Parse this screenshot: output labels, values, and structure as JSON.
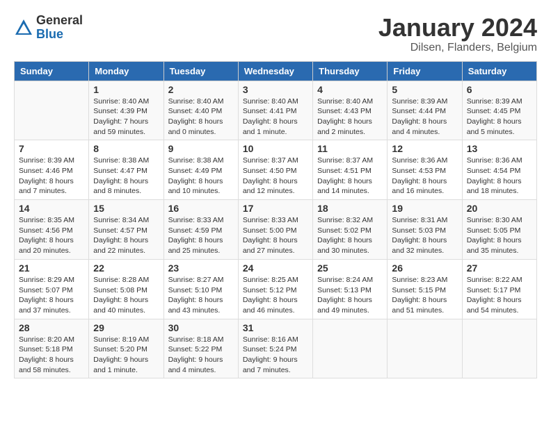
{
  "header": {
    "logo_general": "General",
    "logo_blue": "Blue",
    "month_year": "January 2024",
    "location": "Dilsen, Flanders, Belgium"
  },
  "days_of_week": [
    "Sunday",
    "Monday",
    "Tuesday",
    "Wednesday",
    "Thursday",
    "Friday",
    "Saturday"
  ],
  "weeks": [
    [
      {
        "day": "",
        "content": ""
      },
      {
        "day": "1",
        "content": "Sunrise: 8:40 AM\nSunset: 4:39 PM\nDaylight: 7 hours\nand 59 minutes."
      },
      {
        "day": "2",
        "content": "Sunrise: 8:40 AM\nSunset: 4:40 PM\nDaylight: 8 hours\nand 0 minutes."
      },
      {
        "day": "3",
        "content": "Sunrise: 8:40 AM\nSunset: 4:41 PM\nDaylight: 8 hours\nand 1 minute."
      },
      {
        "day": "4",
        "content": "Sunrise: 8:40 AM\nSunset: 4:43 PM\nDaylight: 8 hours\nand 2 minutes."
      },
      {
        "day": "5",
        "content": "Sunrise: 8:39 AM\nSunset: 4:44 PM\nDaylight: 8 hours\nand 4 minutes."
      },
      {
        "day": "6",
        "content": "Sunrise: 8:39 AM\nSunset: 4:45 PM\nDaylight: 8 hours\nand 5 minutes."
      }
    ],
    [
      {
        "day": "7",
        "content": "Sunrise: 8:39 AM\nSunset: 4:46 PM\nDaylight: 8 hours\nand 7 minutes."
      },
      {
        "day": "8",
        "content": "Sunrise: 8:38 AM\nSunset: 4:47 PM\nDaylight: 8 hours\nand 8 minutes."
      },
      {
        "day": "9",
        "content": "Sunrise: 8:38 AM\nSunset: 4:49 PM\nDaylight: 8 hours\nand 10 minutes."
      },
      {
        "day": "10",
        "content": "Sunrise: 8:37 AM\nSunset: 4:50 PM\nDaylight: 8 hours\nand 12 minutes."
      },
      {
        "day": "11",
        "content": "Sunrise: 8:37 AM\nSunset: 4:51 PM\nDaylight: 8 hours\nand 14 minutes."
      },
      {
        "day": "12",
        "content": "Sunrise: 8:36 AM\nSunset: 4:53 PM\nDaylight: 8 hours\nand 16 minutes."
      },
      {
        "day": "13",
        "content": "Sunrise: 8:36 AM\nSunset: 4:54 PM\nDaylight: 8 hours\nand 18 minutes."
      }
    ],
    [
      {
        "day": "14",
        "content": "Sunrise: 8:35 AM\nSunset: 4:56 PM\nDaylight: 8 hours\nand 20 minutes."
      },
      {
        "day": "15",
        "content": "Sunrise: 8:34 AM\nSunset: 4:57 PM\nDaylight: 8 hours\nand 22 minutes."
      },
      {
        "day": "16",
        "content": "Sunrise: 8:33 AM\nSunset: 4:59 PM\nDaylight: 8 hours\nand 25 minutes."
      },
      {
        "day": "17",
        "content": "Sunrise: 8:33 AM\nSunset: 5:00 PM\nDaylight: 8 hours\nand 27 minutes."
      },
      {
        "day": "18",
        "content": "Sunrise: 8:32 AM\nSunset: 5:02 PM\nDaylight: 8 hours\nand 30 minutes."
      },
      {
        "day": "19",
        "content": "Sunrise: 8:31 AM\nSunset: 5:03 PM\nDaylight: 8 hours\nand 32 minutes."
      },
      {
        "day": "20",
        "content": "Sunrise: 8:30 AM\nSunset: 5:05 PM\nDaylight: 8 hours\nand 35 minutes."
      }
    ],
    [
      {
        "day": "21",
        "content": "Sunrise: 8:29 AM\nSunset: 5:07 PM\nDaylight: 8 hours\nand 37 minutes."
      },
      {
        "day": "22",
        "content": "Sunrise: 8:28 AM\nSunset: 5:08 PM\nDaylight: 8 hours\nand 40 minutes."
      },
      {
        "day": "23",
        "content": "Sunrise: 8:27 AM\nSunset: 5:10 PM\nDaylight: 8 hours\nand 43 minutes."
      },
      {
        "day": "24",
        "content": "Sunrise: 8:25 AM\nSunset: 5:12 PM\nDaylight: 8 hours\nand 46 minutes."
      },
      {
        "day": "25",
        "content": "Sunrise: 8:24 AM\nSunset: 5:13 PM\nDaylight: 8 hours\nand 49 minutes."
      },
      {
        "day": "26",
        "content": "Sunrise: 8:23 AM\nSunset: 5:15 PM\nDaylight: 8 hours\nand 51 minutes."
      },
      {
        "day": "27",
        "content": "Sunrise: 8:22 AM\nSunset: 5:17 PM\nDaylight: 8 hours\nand 54 minutes."
      }
    ],
    [
      {
        "day": "28",
        "content": "Sunrise: 8:20 AM\nSunset: 5:18 PM\nDaylight: 8 hours\nand 58 minutes."
      },
      {
        "day": "29",
        "content": "Sunrise: 8:19 AM\nSunset: 5:20 PM\nDaylight: 9 hours\nand 1 minute."
      },
      {
        "day": "30",
        "content": "Sunrise: 8:18 AM\nSunset: 5:22 PM\nDaylight: 9 hours\nand 4 minutes."
      },
      {
        "day": "31",
        "content": "Sunrise: 8:16 AM\nSunset: 5:24 PM\nDaylight: 9 hours\nand 7 minutes."
      },
      {
        "day": "",
        "content": ""
      },
      {
        "day": "",
        "content": ""
      },
      {
        "day": "",
        "content": ""
      }
    ]
  ]
}
